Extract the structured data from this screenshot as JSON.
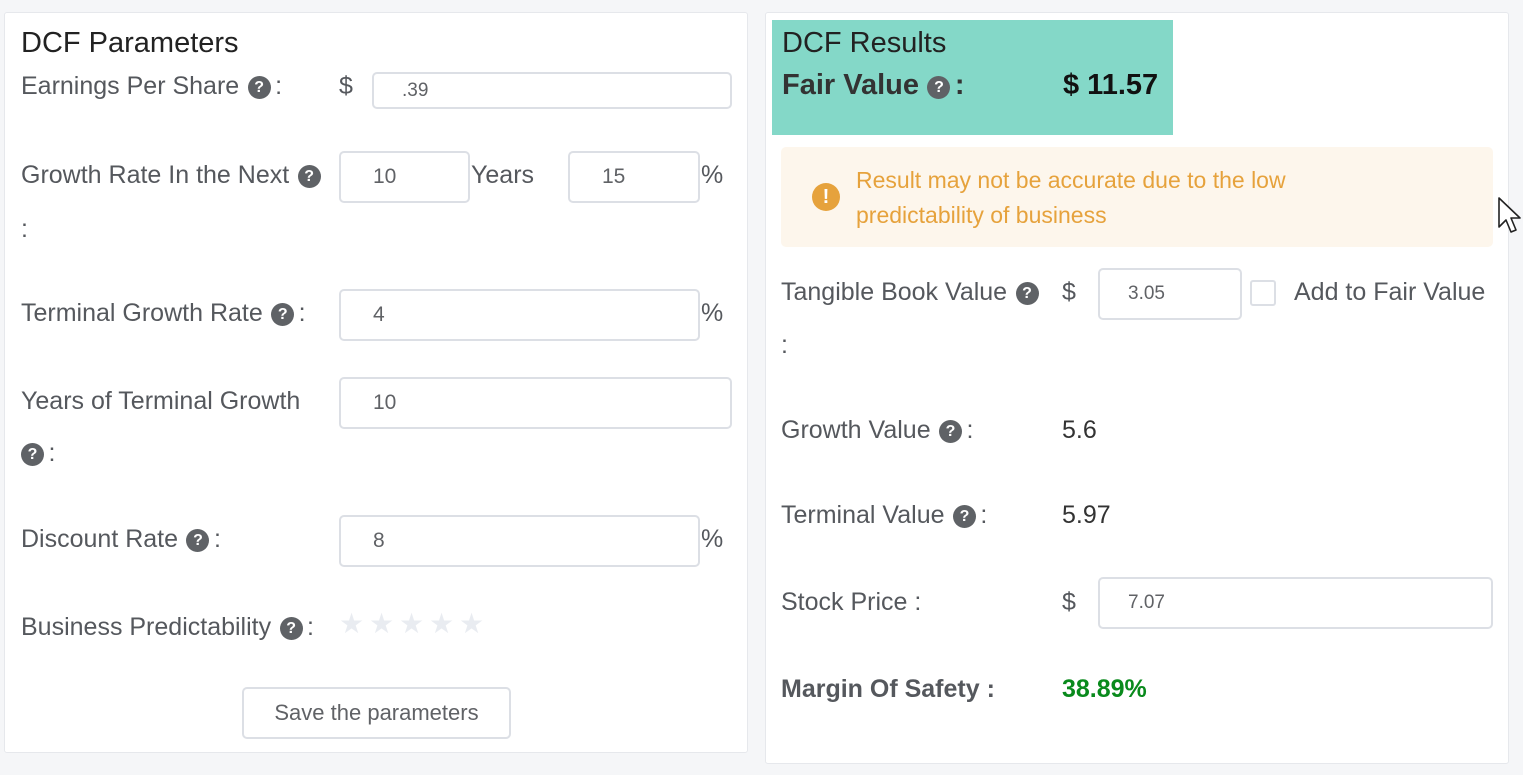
{
  "params": {
    "title": "DCF Parameters",
    "eps": {
      "label": "Earnings Per Share",
      "currency": "$",
      "value": ".39"
    },
    "growth": {
      "label": "Growth Rate In the Next",
      "years_value": "10",
      "years_unit": "Years",
      "rate_value": "15",
      "rate_unit": "%"
    },
    "terminal_growth": {
      "label": "Terminal Growth Rate",
      "value": "4",
      "unit": "%"
    },
    "terminal_years": {
      "label": "Years of Terminal Growth",
      "value": "10"
    },
    "discount": {
      "label": "Discount Rate",
      "value": "8",
      "unit": "%"
    },
    "predictability": {
      "label": "Business Predictability",
      "stars_filled": 0,
      "stars_total": 5
    },
    "save_label": "Save the parameters",
    "colon": ":",
    "help_glyph": "?"
  },
  "results": {
    "title": "DCF Results",
    "fair_value": {
      "label": "Fair Value",
      "value": "$ 11.57"
    },
    "alert": {
      "text": "Result may not be accurate due to the low predictability of business",
      "icon": "!"
    },
    "tangible_book": {
      "label": "Tangible Book Value",
      "currency": "$",
      "value": "3.05",
      "checkbox_label": "Add to Fair Value",
      "checked": false
    },
    "growth_value": {
      "label": "Growth Value",
      "value": "5.6"
    },
    "terminal_value": {
      "label": "Terminal Value",
      "value": "5.97"
    },
    "stock_price": {
      "label": "Stock Price :",
      "currency": "$",
      "value": "7.07"
    },
    "margin": {
      "label": "Margin Of Safety :",
      "value": "38.89%"
    }
  },
  "colors": {
    "result_bg": "#84d8c8",
    "alert_text": "#e6a23c",
    "alert_bg": "#fdf6ec",
    "margin_positive": "#098a1c"
  }
}
